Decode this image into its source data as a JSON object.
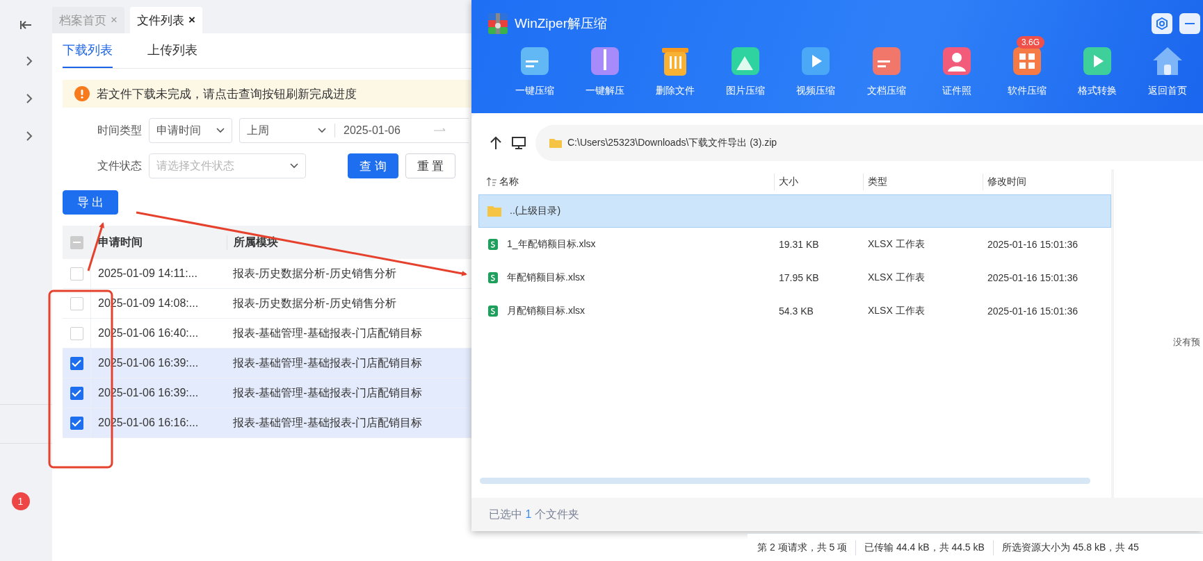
{
  "sidebar": {
    "badge": "1"
  },
  "page_tabs": [
    {
      "label": "档案首页",
      "close": "×",
      "selected": false
    },
    {
      "label": "文件列表",
      "close": "×",
      "selected": true
    }
  ],
  "sub_tabs": [
    {
      "label": "下载列表",
      "selected": true
    },
    {
      "label": "上传列表",
      "selected": false
    }
  ],
  "alert": {
    "text": "若文件下载未完成，请点击查询按钮刷新完成进度"
  },
  "filters": {
    "time_label": "时间类型",
    "time_type": "申请时间",
    "range": "上周",
    "start_date": "2025-01-06",
    "status_label": "文件状态",
    "status_placeholder": "请选择文件状态",
    "buttons": [
      {
        "label": "查 询",
        "primary": true
      },
      {
        "label": "重 置",
        "primary": false
      }
    ]
  },
  "export_button": "导 出",
  "table": {
    "header_indeterminate": true,
    "columns": [
      "申请时间",
      "所属模块"
    ],
    "rows": [
      {
        "time": "2025-01-09 14:11:...",
        "module": "报表-历史数据分析-历史销售分析",
        "checked": false
      },
      {
        "time": "2025-01-09 14:08:...",
        "module": "报表-历史数据分析-历史销售分析",
        "checked": false
      },
      {
        "time": "2025-01-06 16:40:...",
        "module": "报表-基础管理-基础报表-门店配销目标",
        "checked": false
      },
      {
        "time": "2025-01-06 16:39:...",
        "module": "报表-基础管理-基础报表-门店配销目标",
        "checked": true
      },
      {
        "time": "2025-01-06 16:39:...",
        "module": "报表-基础管理-基础报表-门店配销目标",
        "checked": true
      },
      {
        "time": "2025-01-06 16:16:...",
        "module": "报表-基础管理-基础报表-门店配销目标",
        "checked": true
      }
    ]
  },
  "zip_window": {
    "title": "WinZiper解压缩",
    "tools": [
      {
        "label": "一键压缩",
        "kind": "folder"
      },
      {
        "label": "一键解压",
        "kind": "zip"
      },
      {
        "label": "删除文件",
        "kind": "trash"
      },
      {
        "label": "图片压缩",
        "kind": "image"
      },
      {
        "label": "视频压缩",
        "kind": "video"
      },
      {
        "label": "文档压缩",
        "kind": "document"
      },
      {
        "label": "证件照",
        "kind": "person"
      },
      {
        "label": "软件压缩",
        "kind": "software",
        "badge": "3.6G"
      },
      {
        "label": "格式转换",
        "kind": "convert"
      },
      {
        "label": "返回首页",
        "kind": "home"
      }
    ],
    "path": "C:\\Users\\25323\\Downloads\\下载文件导出 (3).zip",
    "columns": [
      "名称",
      "大小",
      "类型",
      "修改时间"
    ],
    "rows": [
      {
        "kind": "folder",
        "name": "..(上级目录)",
        "selected": true
      },
      {
        "kind": "xlsx",
        "name": "1_年配销额目标.xlsx",
        "size": "19.31 KB",
        "type": "XLSX 工作表",
        "modified": "2025-01-16 15:01:36",
        "selected": false
      },
      {
        "kind": "xlsx",
        "name": "年配销额目标.xlsx",
        "size": "17.95 KB",
        "type": "XLSX 工作表",
        "modified": "2025-01-16 15:01:36",
        "selected": false
      },
      {
        "kind": "xlsx",
        "name": "月配销额目标.xlsx",
        "size": "54.3 KB",
        "type": "XLSX 工作表",
        "modified": "2025-01-16 15:01:36",
        "selected": false
      }
    ],
    "preview_text": "没有预",
    "status": {
      "prefix": "已选中",
      "count": "1",
      "suffix": "个文件夹"
    }
  },
  "devtools_status": [
    "第 2 项请求，共 5 项",
    "已传输 44.4 kB，共 44.5 kB",
    "所选资源大小为 45.8 kB，共 45"
  ]
}
